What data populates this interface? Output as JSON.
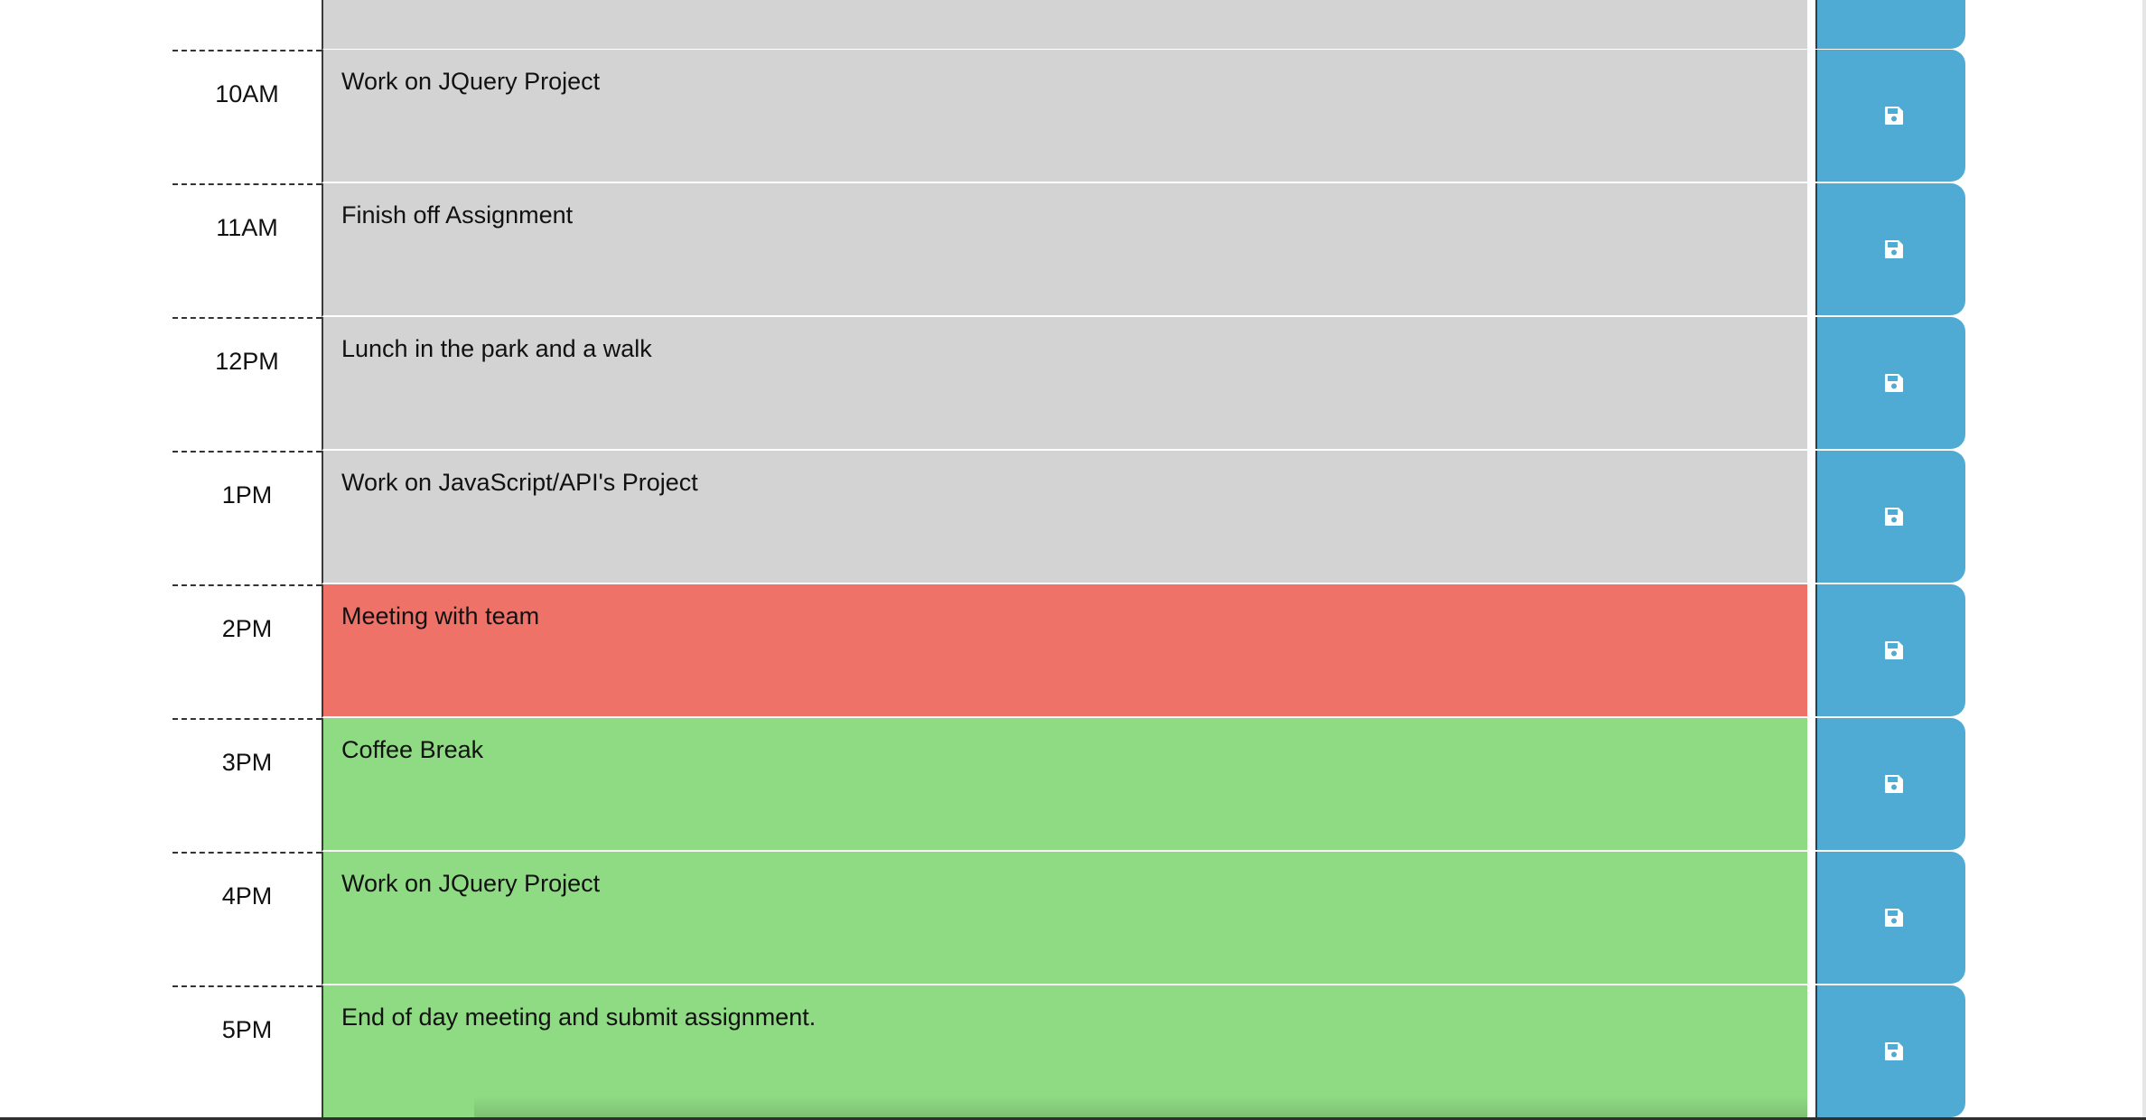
{
  "colors": {
    "past": "#d3d3d3",
    "present": "#ee7268",
    "future": "#8fdb83",
    "save": "#4fabd3"
  },
  "planner": {
    "rows": [
      {
        "hour": "10AM",
        "text": "Work on JQuery Project",
        "state": "past",
        "save_icon": "floppy-disk-icon"
      },
      {
        "hour": "11AM",
        "text": "Finish off Assignment",
        "state": "past",
        "save_icon": "floppy-disk-icon"
      },
      {
        "hour": "12PM",
        "text": "Lunch in the park and a walk",
        "state": "past",
        "save_icon": "floppy-disk-icon"
      },
      {
        "hour": "1PM",
        "text": "Work on JavaScript/API's Project",
        "state": "past",
        "save_icon": "floppy-disk-icon"
      },
      {
        "hour": "2PM",
        "text": "Meeting with team",
        "state": "present",
        "save_icon": "floppy-disk-icon"
      },
      {
        "hour": "3PM",
        "text": "Coffee Break",
        "state": "future",
        "save_icon": "floppy-disk-icon"
      },
      {
        "hour": "4PM",
        "text": "Work on JQuery Project",
        "state": "future",
        "save_icon": "floppy-disk-icon"
      },
      {
        "hour": "5PM",
        "text": "End of day meeting and submit assignment.",
        "state": "future",
        "save_icon": "floppy-disk-icon"
      }
    ]
  }
}
